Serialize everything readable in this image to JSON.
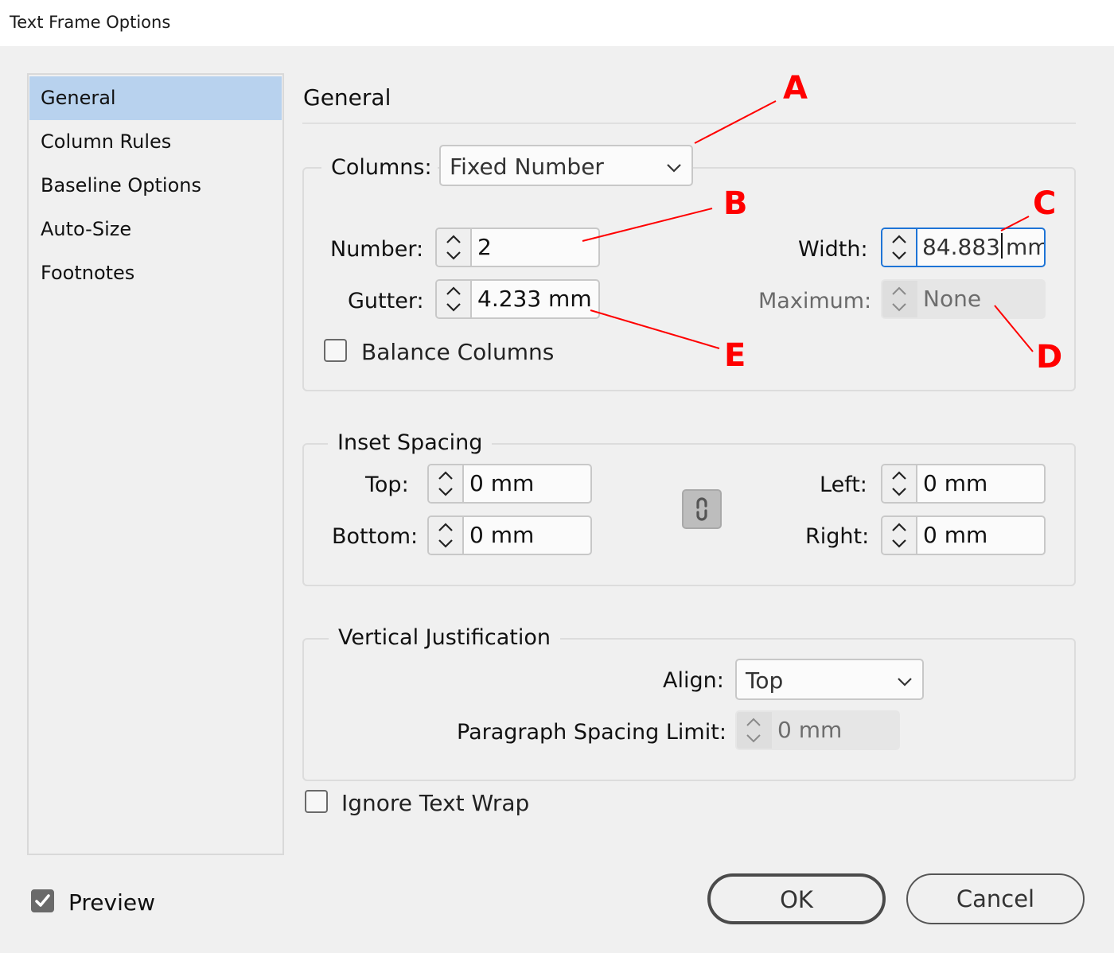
{
  "window": {
    "title": "Text Frame Options"
  },
  "sidebar": {
    "items": [
      {
        "label": "General",
        "active": true
      },
      {
        "label": "Column Rules",
        "active": false
      },
      {
        "label": "Baseline Options",
        "active": false
      },
      {
        "label": "Auto-Size",
        "active": false
      },
      {
        "label": "Footnotes",
        "active": false
      }
    ]
  },
  "main": {
    "heading": "General",
    "columns": {
      "label": "Columns:",
      "type_value": "Fixed Number",
      "number_label": "Number:",
      "number_value": "2",
      "gutter_label": "Gutter:",
      "gutter_value": "4.233 mm",
      "width_label": "Width:",
      "width_value": "84.883",
      "width_unit": "mm",
      "maximum_label": "Maximum:",
      "maximum_value": "None",
      "balance_label": "Balance Columns",
      "balance_checked": false
    },
    "inset": {
      "legend": "Inset Spacing",
      "top_label": "Top:",
      "top_value": "0 mm",
      "bottom_label": "Bottom:",
      "bottom_value": "0 mm",
      "left_label": "Left:",
      "left_value": "0 mm",
      "right_label": "Right:",
      "right_value": "0 mm",
      "link_icon": "chain-link-icon"
    },
    "vertical": {
      "legend": "Vertical Justification",
      "align_label": "Align:",
      "align_value": "Top",
      "para_label": "Paragraph Spacing Limit:",
      "para_value": "0 mm"
    },
    "ignore_wrap": {
      "label": "Ignore Text Wrap",
      "checked": false
    }
  },
  "footer": {
    "preview": {
      "label": "Preview",
      "checked": true
    },
    "ok_label": "OK",
    "cancel_label": "Cancel"
  },
  "annotations": {
    "color": "#ff0000",
    "letters": [
      "A",
      "B",
      "C",
      "D",
      "E"
    ]
  },
  "colors": {
    "selection": "#b8d2ee",
    "focus": "#1e74d6",
    "background": "#f0f0f0"
  }
}
